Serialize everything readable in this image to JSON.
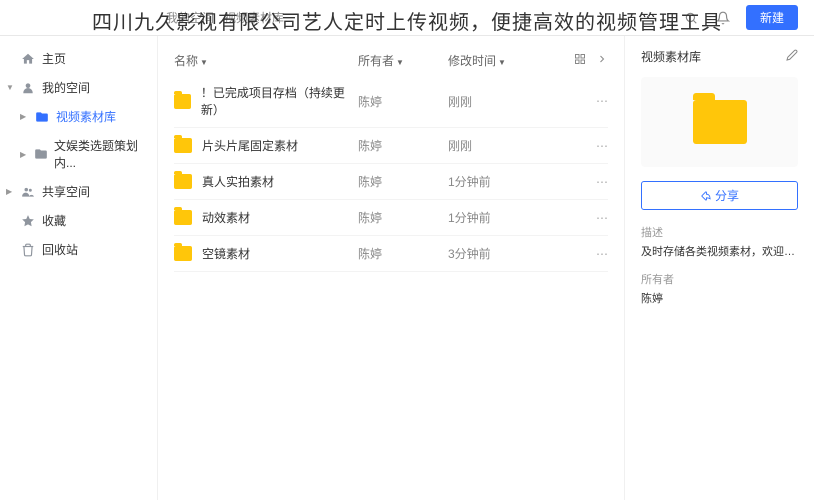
{
  "overlay_title": "四川九久影视有限公司艺人定时上传视频，便捷高效的视频管理工具",
  "breadcrumb": [
    "我的空间",
    "视频素材库"
  ],
  "new_button": "新建",
  "sidebar": {
    "home": "主页",
    "my_space": "我的空间",
    "video_lib": "视频素材库",
    "ent_planning": "文娱类选题策划内...",
    "shared": "共享空间",
    "favorites": "收藏",
    "trash": "回收站"
  },
  "columns": {
    "name": "名称",
    "owner": "所有者",
    "modified": "修改时间"
  },
  "rows": [
    {
      "name": "！已完成项目存档（持续更新）",
      "owner": "陈婷",
      "time": "刚刚"
    },
    {
      "name": "片头片尾固定素材",
      "owner": "陈婷",
      "time": "刚刚"
    },
    {
      "name": "真人实拍素材",
      "owner": "陈婷",
      "time": "1分钟前"
    },
    {
      "name": "动效素材",
      "owner": "陈婷",
      "time": "1分钟前"
    },
    {
      "name": "空镜素材",
      "owner": "陈婷",
      "time": "3分钟前"
    }
  ],
  "details": {
    "title": "视频素材库",
    "share": "分享",
    "desc_label": "描述",
    "desc_value": "及时存储各类视频素材，欢迎大...",
    "owner_label": "所有者",
    "owner_value": "陈婷"
  }
}
